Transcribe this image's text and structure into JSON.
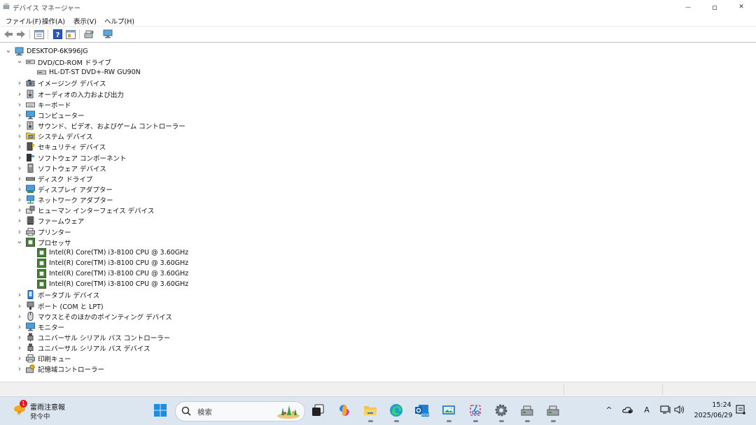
{
  "window": {
    "title": "デバイス マネージャー",
    "minimize_glyph": "—",
    "maximize_glyph": "▫",
    "close_glyph": "✕"
  },
  "menu": [
    "ファイル(F)",
    "操作(A)",
    "表示(V)",
    "ヘルプ(H)"
  ],
  "toolbar_icons": [
    "back-arrow-icon",
    "forward-arrow-icon",
    "properties-icon",
    "help-icon",
    "view-icon",
    "update-driver-icon",
    "scan-hardware-icon"
  ],
  "tree": {
    "root": "DESKTOP-6K996JG",
    "categories": [
      {
        "label": "DVD/CD-ROM ドライブ",
        "icon": "dvd-drive-icon",
        "expanded": true,
        "children": [
          {
            "label": "HL-DT-ST DVD+-RW GU90N",
            "icon": "dvd-drive-icon"
          }
        ]
      },
      {
        "label": "イメージング デバイス",
        "icon": "camera-icon"
      },
      {
        "label": "オーディオの入力および出力",
        "icon": "speaker-icon"
      },
      {
        "label": "キーボード",
        "icon": "keyboard-icon"
      },
      {
        "label": "コンピューター",
        "icon": "monitor-icon"
      },
      {
        "label": "サウンド、ビデオ、およびゲーム コントローラー",
        "icon": "speaker-icon"
      },
      {
        "label": "システム デバイス",
        "icon": "system-folder-icon"
      },
      {
        "label": "セキュリティ デバイス",
        "icon": "security-key-icon"
      },
      {
        "label": "ソフトウェア コンポーネント",
        "icon": "component-icon"
      },
      {
        "label": "ソフトウェア デバイス",
        "icon": "software-device-icon"
      },
      {
        "label": "ディスク ドライブ",
        "icon": "disk-drive-icon"
      },
      {
        "label": "ディスプレイ アダプター",
        "icon": "display-adapter-icon"
      },
      {
        "label": "ネットワーク アダプター",
        "icon": "network-icon"
      },
      {
        "label": "ヒューマン インターフェイス デバイス",
        "icon": "hid-icon"
      },
      {
        "label": "ファームウェア",
        "icon": "firmware-icon"
      },
      {
        "label": "プリンター",
        "icon": "printer-icon"
      },
      {
        "label": "プロセッサ",
        "icon": "processor-icon",
        "expanded": true,
        "children": [
          {
            "label": "Intel(R) Core(TM) i3-8100 CPU @ 3.60GHz",
            "icon": "processor-icon"
          },
          {
            "label": "Intel(R) Core(TM) i3-8100 CPU @ 3.60GHz",
            "icon": "processor-icon"
          },
          {
            "label": "Intel(R) Core(TM) i3-8100 CPU @ 3.60GHz",
            "icon": "processor-icon"
          },
          {
            "label": "Intel(R) Core(TM) i3-8100 CPU @ 3.60GHz",
            "icon": "processor-icon"
          }
        ]
      },
      {
        "label": "ポータブル デバイス",
        "icon": "portable-device-icon"
      },
      {
        "label": "ポート (COM と LPT)",
        "icon": "port-icon"
      },
      {
        "label": "マウスとそのほかのポインティング デバイス",
        "icon": "mouse-icon"
      },
      {
        "label": "モニター",
        "icon": "monitor-icon"
      },
      {
        "label": "ユニバーサル シリアル バス コントローラー",
        "icon": "usb-icon"
      },
      {
        "label": "ユニバーサル シリアル バス デバイス",
        "icon": "usb-icon"
      },
      {
        "label": "印刷キュー",
        "icon": "printer-icon"
      },
      {
        "label": "記憶域コントローラー",
        "icon": "storage-controller-icon"
      }
    ]
  },
  "taskbar": {
    "weather": {
      "badge": "1",
      "line1": "雷雨注意報",
      "line2": "発令中"
    },
    "search_placeholder": "検索",
    "apps": [
      "start-icon",
      "task-view-icon",
      "copilot-icon",
      "file-explorer-icon",
      "edge-icon",
      "outlook-new-icon",
      "photos-icon",
      "snipping-tool-icon",
      "settings-icon",
      "device-manager-icon",
      "device-manager-icon"
    ],
    "tray": {
      "ime": "A",
      "time": "15:24",
      "date": "2025/06/29"
    }
  },
  "colors": {
    "accent": "#0078d4",
    "taskbar": "#dce6f0",
    "folder": "#f2c14e"
  }
}
